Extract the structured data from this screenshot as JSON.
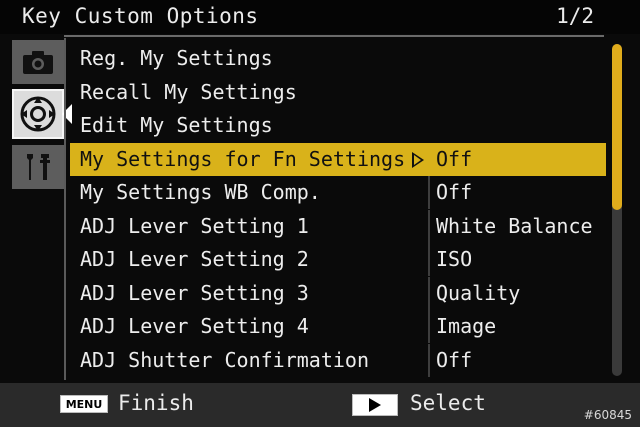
{
  "header": {
    "title": "Key Custom Options",
    "page": "1/2"
  },
  "tabs": [
    {
      "id": "camera",
      "icon": "camera-icon",
      "active": false
    },
    {
      "id": "key-custom",
      "icon": "directional-pad-icon",
      "active": true
    },
    {
      "id": "setup",
      "icon": "wrench-icon",
      "active": false
    }
  ],
  "menu": {
    "items": [
      {
        "label": "Reg. My Settings",
        "value": ""
      },
      {
        "label": "Recall My Settings",
        "value": ""
      },
      {
        "label": "Edit My Settings",
        "value": ""
      },
      {
        "label": "My Settings for Fn Settings",
        "value": "Off",
        "selected": true
      },
      {
        "label": "My Settings WB Comp.",
        "value": "Off"
      },
      {
        "label": "ADJ Lever Setting 1",
        "value": "White Balance"
      },
      {
        "label": "ADJ Lever Setting 2",
        "value": "ISO"
      },
      {
        "label": "ADJ Lever Setting 3",
        "value": "Quality"
      },
      {
        "label": "ADJ Lever Setting 4",
        "value": "Image"
      },
      {
        "label": "ADJ Shutter Confirmation",
        "value": "Off"
      }
    ]
  },
  "scrollbar": {
    "visible_fraction": 0.5,
    "position_fraction": 0.0
  },
  "footer": {
    "menu_key": "MENU",
    "menu_action": "Finish",
    "play_key_icon": "play-icon",
    "play_action": "Select"
  },
  "watermark": "#60845",
  "colors": {
    "highlight": "#d9b21a",
    "scroll_thumb": "#e0ac1c",
    "background": "#0a0a0a"
  }
}
